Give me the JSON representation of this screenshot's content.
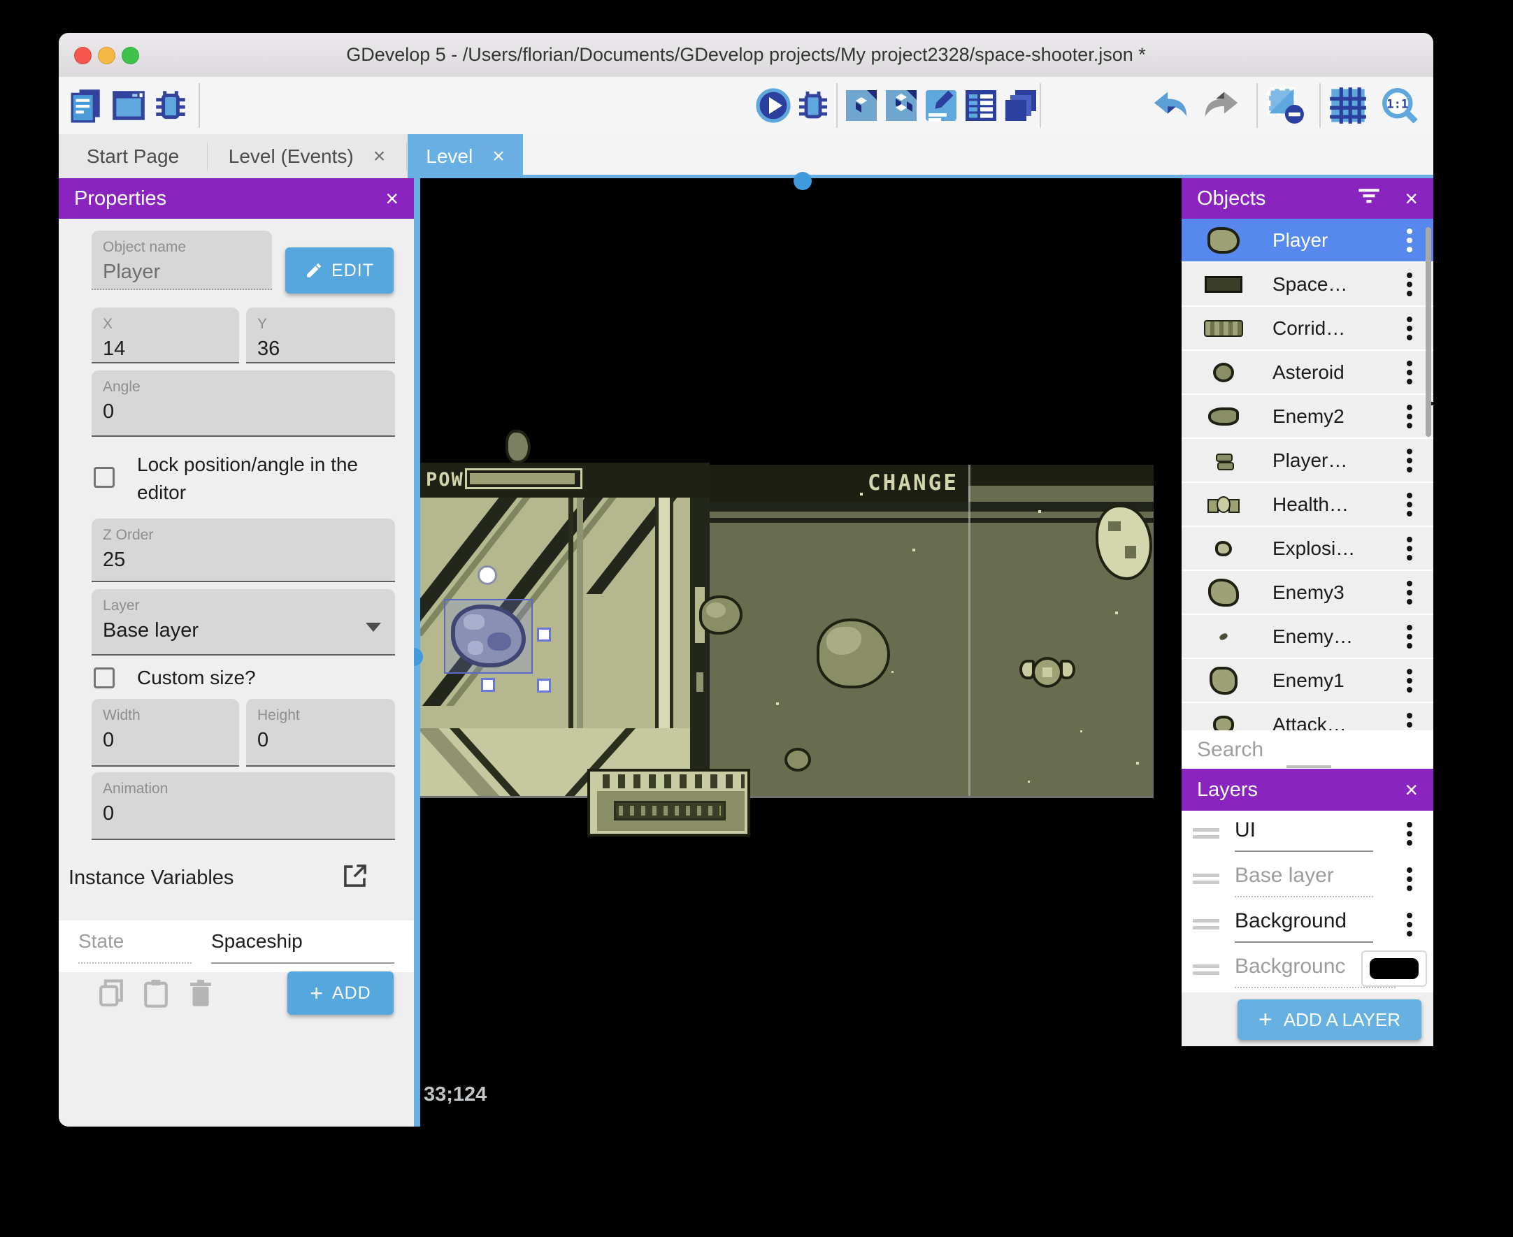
{
  "window": {
    "title": "GDevelop 5 - /Users/florian/Documents/GDevelop projects/My project2328/space-shooter.json *"
  },
  "tabs": {
    "start_page": "Start Page",
    "level_events": "Level (Events)",
    "level": "Level"
  },
  "properties": {
    "title": "Properties",
    "object_name_label": "Object name",
    "object_name_value": "Player",
    "edit_button": "EDIT",
    "x_label": "X",
    "x_value": "14",
    "y_label": "Y",
    "y_value": "36",
    "angle_label": "Angle",
    "angle_value": "0",
    "lock_checkbox_label": "Lock position/angle in the editor",
    "z_order_label": "Z Order",
    "z_order_value": "25",
    "layer_label": "Layer",
    "layer_value": "Base layer",
    "custom_size_checkbox_label": "Custom size?",
    "width_label": "Width",
    "width_value": "0",
    "height_label": "Height",
    "height_value": "0",
    "animation_label": "Animation",
    "animation_value": "0",
    "instance_variables_title": "Instance Variables",
    "variables": [
      {
        "name": "State",
        "value": "Spaceship"
      }
    ],
    "add_button": "ADD"
  },
  "scene": {
    "hud_pow": "POW",
    "hud_change": "CHANGE",
    "cursor_coordinates": "33;124"
  },
  "objects_panel": {
    "title": "Objects",
    "search_placeholder": "Search",
    "items": [
      {
        "label": "Player"
      },
      {
        "label": "Space…"
      },
      {
        "label": "Corrid…"
      },
      {
        "label": "Asteroid"
      },
      {
        "label": "Enemy2"
      },
      {
        "label": "Player…"
      },
      {
        "label": "Health…"
      },
      {
        "label": "Explosi…"
      },
      {
        "label": "Enemy3"
      },
      {
        "label": "Enemy…"
      },
      {
        "label": "Enemy1"
      },
      {
        "label": "Attack…"
      }
    ]
  },
  "layers_panel": {
    "title": "Layers",
    "add_layer_button": "ADD A LAYER",
    "layers": [
      {
        "name": "UI"
      },
      {
        "name": "Base layer"
      },
      {
        "name": "Background"
      },
      {
        "name": "Backgrounc"
      }
    ]
  },
  "colors": {
    "accent_purple": "#8A24BE",
    "selection_blue": "#5688EE",
    "tab_blue": "#68B0E3",
    "button_blue": "#55A7DE"
  }
}
